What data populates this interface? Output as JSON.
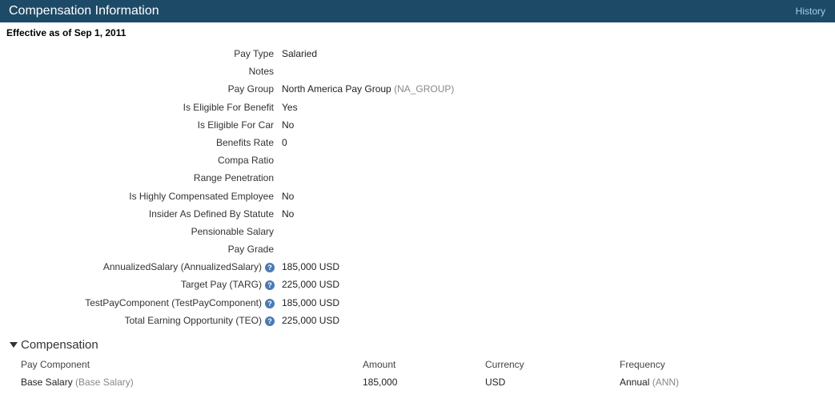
{
  "header": {
    "title": "Compensation Information",
    "history_link": "History"
  },
  "effective_date": "Effective as of Sep 1, 2011",
  "fields": [
    {
      "label": "Pay Type",
      "value": "Salaried",
      "code": "",
      "help": false
    },
    {
      "label": "Notes",
      "value": "",
      "code": "",
      "help": false
    },
    {
      "label": "Pay Group",
      "value": "North America Pay Group",
      "code": "(NA_GROUP)",
      "help": false
    },
    {
      "label": "Is Eligible For Benefit",
      "value": "Yes",
      "code": "",
      "help": false
    },
    {
      "label": "Is Eligible For Car",
      "value": "No",
      "code": "",
      "help": false
    },
    {
      "label": "Benefits Rate",
      "value": "0",
      "code": "",
      "help": false
    },
    {
      "label": "Compa Ratio",
      "value": "",
      "code": "",
      "help": false
    },
    {
      "label": "Range Penetration",
      "value": "",
      "code": "",
      "help": false
    },
    {
      "label": "Is Highly Compensated Employee",
      "value": "No",
      "code": "",
      "help": false
    },
    {
      "label": "Insider As Defined By Statute",
      "value": "No",
      "code": "",
      "help": false
    },
    {
      "label": "Pensionable Salary",
      "value": "",
      "code": "",
      "help": false
    },
    {
      "label": "Pay Grade",
      "value": "",
      "code": "",
      "help": false
    },
    {
      "label": "AnnualizedSalary (AnnualizedSalary)",
      "value": "185,000 USD",
      "code": "",
      "help": true
    },
    {
      "label": "Target Pay (TARG)",
      "value": "225,000 USD",
      "code": "",
      "help": true
    },
    {
      "label": "TestPayComponent (TestPayComponent)",
      "value": "185,000 USD",
      "code": "",
      "help": true
    },
    {
      "label": "Total Earning Opportunity (TEO)",
      "value": "225,000 USD",
      "code": "",
      "help": true
    }
  ],
  "help_icon_glyph": "?",
  "compensation": {
    "title": "Compensation",
    "columns": [
      "Pay Component",
      "Amount",
      "Currency",
      "Frequency"
    ],
    "rows": [
      {
        "pay_component": "Base Salary",
        "pay_component_code": "(Base Salary)",
        "amount": "185,000",
        "currency": "USD",
        "frequency": "Annual",
        "frequency_code": "(ANN)"
      }
    ]
  },
  "colors": {
    "header_bg": "#1d4a67",
    "link": "#9fd0f0",
    "help_icon": "#4a7ab3"
  }
}
